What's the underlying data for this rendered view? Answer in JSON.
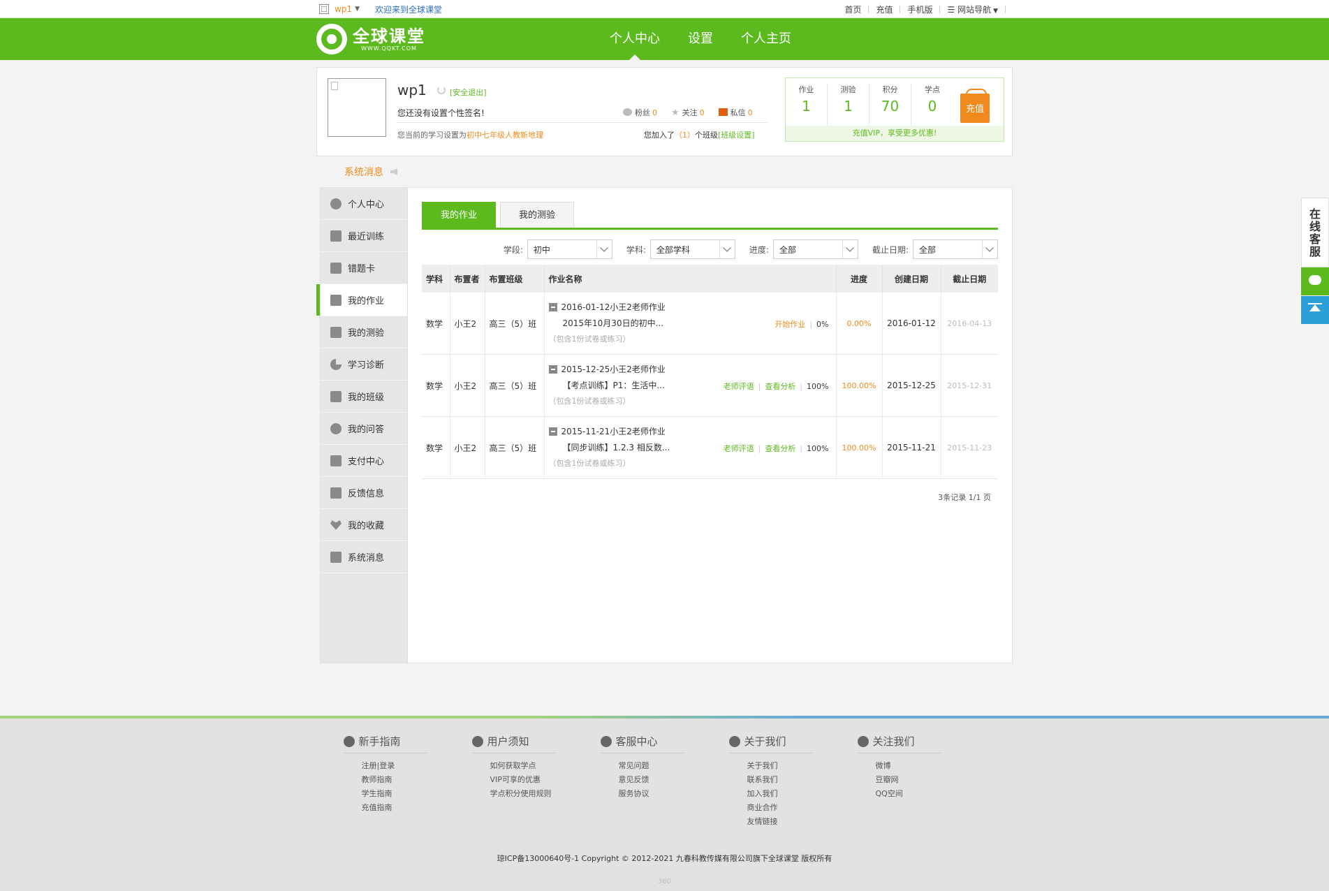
{
  "topbar": {
    "user": "wp1",
    "welcome": "欢迎来到全球课堂",
    "links": [
      "首页",
      "充值",
      "手机版",
      "网站导航"
    ]
  },
  "header": {
    "logo_cn": "全球课堂",
    "logo_en": "WWW.QQKT.COM",
    "nav": [
      "个人中心",
      "设置",
      "个人主页"
    ]
  },
  "profile": {
    "name": "wp1",
    "logout": "[安全退出]",
    "signature": "您还没有设置个性签名!",
    "fans_label": "粉丝",
    "fans": "0",
    "follow_label": "关注",
    "follow": "0",
    "msg_label": "私信",
    "msg": "0",
    "study_prefix": "您当前的学习设置为",
    "study_value": "初中七年级人教新地理",
    "class_prefix": "您加入了",
    "class_count": "（1）",
    "class_suffix": "个班级",
    "class_link": "[班级设置]"
  },
  "scores": {
    "items": [
      {
        "label": "作业",
        "value": "1"
      },
      {
        "label": "测验",
        "value": "1"
      },
      {
        "label": "积分",
        "value": "70"
      },
      {
        "label": "学点",
        "value": "0"
      }
    ],
    "recharge": "充值",
    "vip_text": "充值VIP，享受更多优惠!"
  },
  "sysmsg": "系统消息",
  "sidebar": [
    {
      "label": "个人中心"
    },
    {
      "label": "最近训练"
    },
    {
      "label": "错题卡"
    },
    {
      "label": "我的作业"
    },
    {
      "label": "我的测验"
    },
    {
      "label": "学习诊断"
    },
    {
      "label": "我的班级"
    },
    {
      "label": "我的问答"
    },
    {
      "label": "支付中心"
    },
    {
      "label": "反馈信息"
    },
    {
      "label": "我的收藏"
    },
    {
      "label": "系统消息"
    }
  ],
  "tabs": [
    "我的作业",
    "我的测验"
  ],
  "filters": [
    {
      "label": "学段:",
      "value": "初中"
    },
    {
      "label": "学科:",
      "value": "全部学科"
    },
    {
      "label": "进度:",
      "value": "全部"
    },
    {
      "label": "截止日期:",
      "value": "全部"
    }
  ],
  "table": {
    "headers": [
      "学科",
      "布置者",
      "布置班级",
      "作业名称",
      "进度",
      "创建日期",
      "截止日期"
    ],
    "rows": [
      {
        "subject": "数学",
        "teacher": "小王2",
        "class": "高三（5）班",
        "title": "2016-01-12小王2老师作业",
        "sub": "2015年10月30日的初中...",
        "note": "（包含1份试卷或练习）",
        "act1": "开始作业",
        "act2": "",
        "done": "0%",
        "progress": "0.00%",
        "created": "2016-01-12",
        "due": "2016-04-13"
      },
      {
        "subject": "数学",
        "teacher": "小王2",
        "class": "高三（5）班",
        "title": "2015-12-25小王2老师作业",
        "sub": "【考点训练】P1：生活中...",
        "note": "（包含1份试卷或练习）",
        "act1": "老师评语",
        "act2": "查看分析",
        "done": "100%",
        "progress": "100.00%",
        "created": "2015-12-25",
        "due": "2015-12-31"
      },
      {
        "subject": "数学",
        "teacher": "小王2",
        "class": "高三（5）班",
        "title": "2015-11-21小王2老师作业",
        "sub": "【同步训练】1.2.3 相反数...",
        "note": "（包含1份试卷或练习）",
        "act1": "老师评语",
        "act2": "查看分析",
        "done": "100%",
        "progress": "100.00%",
        "created": "2015-11-21",
        "due": "2015-11-23"
      }
    ]
  },
  "pager": "3条记录 1/1 页",
  "footer": {
    "cols": [
      {
        "head": "新手指南",
        "links": [
          "注册|登录",
          "教师指南",
          "学生指南",
          "充值指南"
        ]
      },
      {
        "head": "用户须知",
        "links": [
          "如何获取学点",
          "VIP可享的优惠",
          "学点积分使用规则"
        ]
      },
      {
        "head": "客服中心",
        "links": [
          "常见问题",
          "意见反馈",
          "服务协议"
        ]
      },
      {
        "head": "关于我们",
        "links": [
          "关于我们",
          "联系我们",
          "加入我们",
          "商业合作",
          "友情链接"
        ]
      },
      {
        "head": "关注我们",
        "links": [
          "微博",
          "豆瓣网",
          "QQ空间"
        ]
      }
    ],
    "copyright": "琼ICP备13000640号-1 Copyright © 2012-2021 九春科教传媒有限公司旗下全球课堂 版权所有",
    "num": "360"
  },
  "float": {
    "cs": "在线客服"
  }
}
